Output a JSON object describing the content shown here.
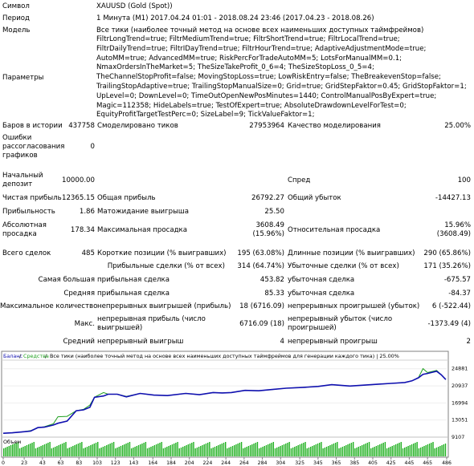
{
  "report": {
    "symbol_label": "Символ",
    "symbol_value": "XAUUSD (Gold (Spot))",
    "period_label": "Период",
    "period_value": "1 Минута (M1) 2017.04.24 01:01 - 2018.08.24 23:46 (2017.04.23 - 2018.08.26)",
    "model_label": "Модель",
    "model_value": "Все тики (наиболее точный метод на основе всех наименьших доступных таймфреймов)",
    "params_label": "Параметры",
    "params_value": "FiltrLongTrend=true; FiltrMediumTrend=true; FiltrShortTrend=true; FiltrLocalTrend=true; FiltrDailyTrend=true; FiltrIDayTrend=true; FiltrHourTrend=true; AdaptiveAdjustmentMode=true; AutoMM=true; AdvancedMM=true; RiskPercForTradeAutoMM=5; LotsForManualMM=0.1; NmaxOrdersInTheMarket=5; TheSizeTakeProfit_0_6=4; TheSizeStopLoss_0_5=4; TheChannelStopProfit=false; MovingStopLoss=true; LowRiskEntry=false; TheBreakevenStop=false; TrailingStopAdaptive=true; TrailingStopManualSize=0; Grid=true; GridStepFaktor=0.45; GridStopFaktor=1; UpLevel=0; DownLevel=0; TimeOutOpenNewPosMinutes=1440; ControlManualPosByExpert=true; Magic=112358; HideLabels=true; TestOfExpert=true; AbsoluteDrawdownLevelForTest=0; EquityProfitTargetTestPerc=0; SizeLabel=9; TickValueFaktor=1;",
    "bars_label": "Баров в истории",
    "bars_value": "437758",
    "ticks_label": "Смоделировано тиков",
    "ticks_value": "27953964",
    "quality_label": "Качество моделирования",
    "quality_value": "25.00%",
    "errors_label_1": "Ошибки",
    "errors_label_2": "рассогласования",
    "errors_label_3": "графиков",
    "errors_value": "0",
    "deposit_label_1": "Начальный",
    "deposit_label_2": "депозит",
    "deposit_value": "10000.00",
    "spread_label": "Спред",
    "spread_value": "100",
    "net_profit_label": "Чистая прибыль",
    "net_profit_value": "12365.15",
    "gross_profit_label": "Общая прибыль",
    "gross_profit_value": "26792.27",
    "gross_loss_label": "Общий убыток",
    "gross_loss_value": "-14427.13",
    "profit_factor_label": "Прибыльность",
    "profit_factor_value": "1.86",
    "expected_payoff_label": "Матожидание выигрыша",
    "expected_payoff_value": "25.50",
    "abs_dd_label_1": "Абсолютная",
    "abs_dd_label_2": "просадка",
    "abs_dd_value": "178.34",
    "max_dd_label": "Максимальная просадка",
    "max_dd_value_1": "3608.49",
    "max_dd_value_2": "(15.96%)",
    "rel_dd_label": "Относительная просадка",
    "rel_dd_value_1": "15.96%",
    "rel_dd_value_2": "(3608.49)",
    "total_trades_label": "Всего сделок",
    "total_trades_value": "485",
    "short_label": "Короткие позиции (% выигравших)",
    "short_value": "195 (63.08%)",
    "long_label": "Длинные позиции (% выигравших)",
    "long_value": "290 (65.86%)",
    "profit_trades_label": "Прибыльные сделки (% от всех)",
    "profit_trades_value": "314 (64.74%)",
    "loss_trades_label": "Убыточные сделки (% от всех)",
    "loss_trades_value": "171 (35.26%)",
    "largest_label": "Самая большая",
    "largest_profit_label": "прибыльная сделка",
    "largest_profit_value": "453.82",
    "largest_loss_label": "убыточная сделка",
    "largest_loss_value": "-675.57",
    "average_label": "Средняя",
    "average_profit_label": "прибыльная сделка",
    "average_profit_value": "85.33",
    "average_loss_label": "убыточная сделка",
    "average_loss_value": "-84.37",
    "max_count_label": "Максимальное количество",
    "cons_wins_label": "непрерывных выигрышей (прибыль)",
    "cons_wins_value": "18 (6716.09)",
    "cons_losses_label": "непрерывных проигрышей (убыток)",
    "cons_losses_value": "6 (-522.44)",
    "max_label": "Макс.",
    "cons_profit_label_1": "непрерывная прибыль (число",
    "cons_profit_label_2": "выигрышей)",
    "cons_profit_value": "6716.09 (18)",
    "cons_loss_label_1": "непрерывный убыток (число",
    "cons_loss_label_2": "проигрышей)",
    "cons_loss_value": "-1373.49 (4)",
    "avg_cons_label": "Средний",
    "avg_cons_wins_label": "непрерывный выигрыш",
    "avg_cons_wins_value": "4",
    "avg_cons_losses_label": "непрерывный проигрыш",
    "avg_cons_losses_value": "2"
  },
  "chart_data": {
    "type": "line",
    "legend": {
      "balance_label": "Баланс",
      "funds_label": "Средства",
      "note": "Все тики (наиболее точный метод на основе всех наименьших доступных таймфреймов для генерации каждого тика) | 25.00%"
    },
    "volume_label": "Объем",
    "ylim": [
      9107,
      26500
    ],
    "y_ticks": [
      "24881",
      "20937",
      "16994",
      "13051",
      "9107"
    ],
    "x_ticks": [
      "0",
      "23",
      "43",
      "63",
      "83",
      "103",
      "123",
      "143",
      "164",
      "184",
      "204",
      "224",
      "244",
      "264",
      "284",
      "304",
      "325",
      "345",
      "365",
      "385",
      "405",
      "425",
      "445",
      "465",
      "486"
    ],
    "x": [
      0,
      10,
      20,
      30,
      38,
      45,
      55,
      60,
      70,
      80,
      88,
      95,
      100,
      110,
      115,
      125,
      135,
      150,
      165,
      180,
      200,
      215,
      230,
      240,
      250,
      265,
      280,
      295,
      310,
      330,
      345,
      360,
      380,
      395,
      410,
      425,
      440,
      448,
      455,
      460,
      465,
      475,
      480,
      485
    ],
    "series": [
      {
        "name": "Баланс",
        "color": "#1010b0",
        "values": [
          10000,
          10100,
          10300,
          10500,
          11300,
          11400,
          11900,
          12300,
          12800,
          15200,
          15400,
          16000,
          18300,
          18600,
          19000,
          19000,
          18400,
          19200,
          18800,
          18700,
          19200,
          18900,
          19400,
          19300,
          19400,
          19900,
          19800,
          20100,
          20400,
          20600,
          20800,
          21200,
          20900,
          21100,
          21300,
          21500,
          21700,
          22100,
          22800,
          23600,
          23800,
          24300,
          23500,
          22400
        ]
      },
      {
        "name": "Средства",
        "color": "#20a020",
        "values": [
          10000,
          10100,
          10300,
          10600,
          11300,
          11500,
          12200,
          13800,
          13900,
          15200,
          15500,
          16500,
          18300,
          19400,
          19000,
          19000,
          18500,
          19200,
          18800,
          18700,
          19200,
          18900,
          19400,
          19300,
          19400,
          19900,
          19800,
          20100,
          20400,
          20600,
          20800,
          21200,
          20900,
          21100,
          21300,
          21500,
          21700,
          22100,
          22800,
          24900,
          24000,
          24500,
          23500,
          22400
        ]
      }
    ]
  }
}
